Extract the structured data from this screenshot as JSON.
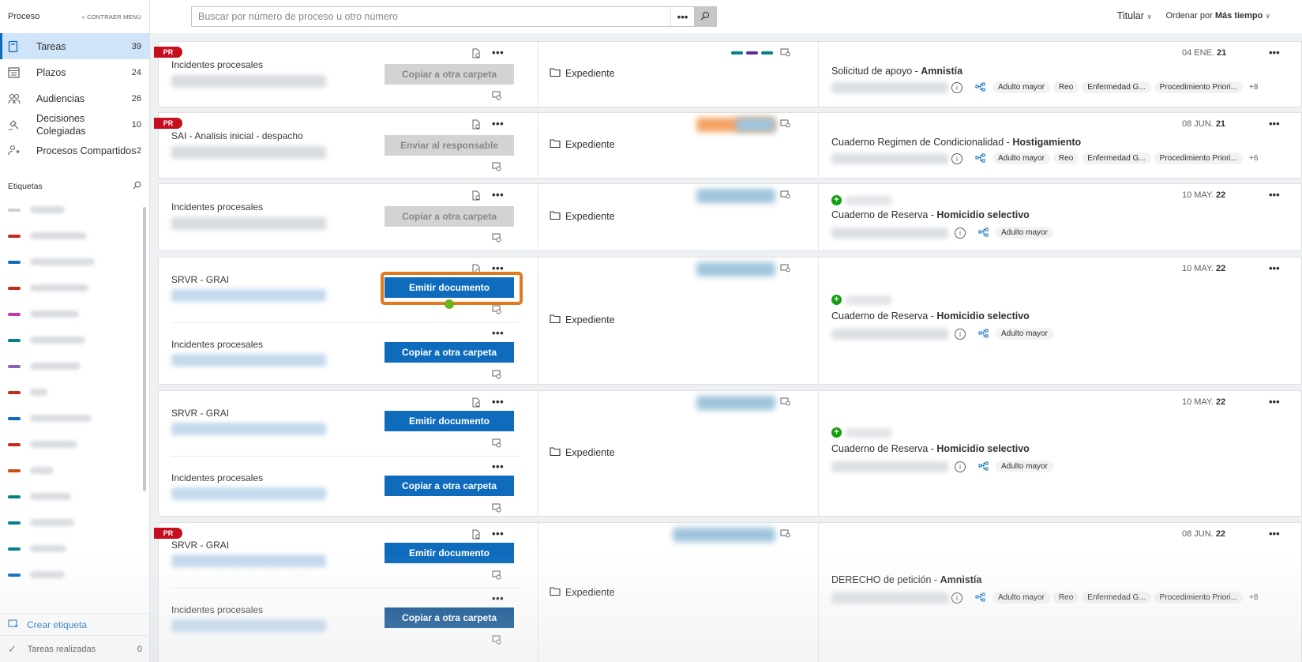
{
  "sidebar": {
    "title": "Proceso",
    "collapse_label": "CONTRAER MENÚ",
    "items": [
      {
        "label": "Tareas",
        "count": "39",
        "icon": "tasks-icon"
      },
      {
        "label": "Plazos",
        "count": "24",
        "icon": "calendar-icon"
      },
      {
        "label": "Audiencias",
        "count": "26",
        "icon": "people-icon"
      },
      {
        "label": "Decisiones Colegiadas",
        "count": "10",
        "icon": "gavel-icon"
      },
      {
        "label": "Procesos Compartidos",
        "count": "2",
        "icon": "shared-people-icon"
      }
    ],
    "tags_title": "Etiquetas",
    "tag_colors": [
      "#d0d0d0",
      "#c42b1c",
      "#0f6cbd",
      "#c42b1c",
      "#c239b3",
      "#038387",
      "#8764b8",
      "#c42b1c",
      "#0f6cbd",
      "#c42b1c",
      "#ca5010",
      "#038387",
      "#038387",
      "#038387",
      "#0f6cbd"
    ],
    "create_tag": "Crear etiqueta",
    "done_tasks": "Tareas realizadas",
    "done_count": "0"
  },
  "topbar": {
    "search_placeholder": "Buscar por número de proceso u otro número",
    "more": "•••",
    "titular": "Titular",
    "order_prefix": "Ordenar por",
    "order_value": "Más tiempo"
  },
  "common": {
    "expediente": "Expediente",
    "dots": "•••"
  },
  "cards": [
    {
      "pr": "PR",
      "subs": [
        {
          "name": "Incidentes procesales",
          "button": "Copiar a otra carpeta"
        }
      ],
      "date_prefix": "04 ENE.",
      "date_year": "21",
      "case_title": "Solicitud de apoyo",
      "case_bold": "Amnistía",
      "chips": [
        "Adulto mayor",
        "Reo",
        "Enfermedad G...",
        "Procedimiento Priori..."
      ],
      "chips_more": "+8"
    },
    {
      "pr": "PR",
      "subs": [
        {
          "name": "SAI - Analisis inicial - despacho",
          "button": "Enviar al responsable"
        }
      ],
      "date_prefix": "08 JUN.",
      "date_year": "21",
      "case_title": "Cuaderno Regimen de Condicionalidad",
      "case_bold": "Hostigamiento",
      "chips": [
        "Adulto mayor",
        "Reo",
        "Enfermedad G...",
        "Procedimiento Priori..."
      ],
      "chips_more": "+6"
    },
    {
      "subs": [
        {
          "name": "Incidentes procesales",
          "button": "Copiar a otra carpeta"
        }
      ],
      "date_prefix": "10 MAY.",
      "date_year": "22",
      "case_title": "Cuaderno de Reserva",
      "case_bold": "Homicidio selectivo",
      "chips": [
        "Adulto mayor"
      ]
    },
    {
      "subs": [
        {
          "name": "SRVR - GRAI",
          "button": "Emitir documento"
        },
        {
          "name": "Incidentes procesales",
          "button": "Copiar a otra carpeta"
        }
      ],
      "date_prefix": "10 MAY.",
      "date_year": "22",
      "case_title": "Cuaderno de Reserva",
      "case_bold": "Homicidio selectivo",
      "chips": [
        "Adulto mayor"
      ]
    },
    {
      "subs": [
        {
          "name": "SRVR - GRAI",
          "button": "Emitir documento"
        },
        {
          "name": "Incidentes procesales",
          "button": "Copiar a otra carpeta"
        }
      ],
      "date_prefix": "10 MAY.",
      "date_year": "22",
      "case_title": "Cuaderno de Reserva",
      "case_bold": "Homicidio selectivo",
      "chips": [
        "Adulto mayor"
      ]
    },
    {
      "pr": "PR",
      "subs": [
        {
          "name": "SRVR - GRAI",
          "button": "Emitir documento"
        },
        {
          "name": "Incidentes procesales",
          "button": "Copiar a otra carpeta"
        }
      ],
      "date_prefix": "08 JUN.",
      "date_year": "22",
      "case_title": "DERECHO de petición",
      "case_bold": "Amnistía",
      "chips": [
        "Adulto mayor",
        "Reo",
        "Enfermedad G...",
        "Procedimiento Priori..."
      ],
      "chips_more": "+8"
    }
  ]
}
